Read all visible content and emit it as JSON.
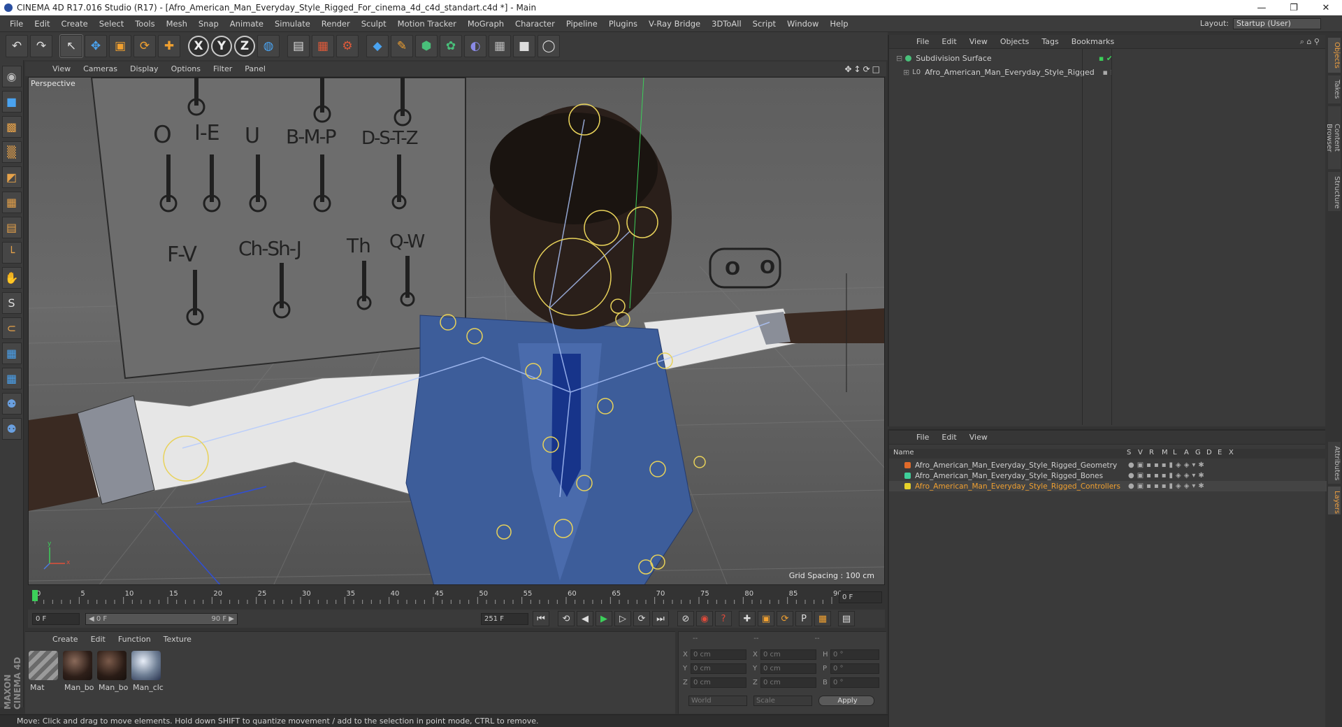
{
  "window": {
    "title": "CINEMA 4D R17.016 Studio (R17) - [Afro_American_Man_Everyday_Style_Rigged_For_cinema_4d_c4d_standart.c4d *] - Main",
    "controls": [
      "—",
      "❐",
      "✕"
    ]
  },
  "menu": [
    "File",
    "Edit",
    "Create",
    "Select",
    "Tools",
    "Mesh",
    "Snap",
    "Animate",
    "Simulate",
    "Render",
    "Sculpt",
    "Motion Tracker",
    "MoGraph",
    "Character",
    "Pipeline",
    "Plugins",
    "V-Ray Bridge",
    "3DToAll",
    "Script",
    "Window",
    "Help"
  ],
  "layout": {
    "label": "Layout:",
    "value": "Startup (User)"
  },
  "toolbar": {
    "icons": [
      "undo-icon",
      "redo-icon",
      "select-arrow-icon",
      "move-icon",
      "scale-icon",
      "rotate-icon",
      "live-move-icon",
      "x-axis-icon",
      "y-axis-icon",
      "z-axis-icon",
      "world-coord-icon",
      "render-view-icon",
      "render-region-icon",
      "render-settings-icon",
      "cube-icon",
      "pen-icon",
      "subdivision-icon",
      "deformer-icon",
      "environment-icon",
      "floor-icon",
      "camera-icon",
      "light-icon"
    ],
    "glyphs": [
      "↶",
      "↷",
      "↖",
      "✥",
      "▣",
      "⟳",
      "✚",
      "X",
      "Y",
      "Z",
      "◍",
      "▤",
      "▦",
      "⚙",
      "◆",
      "✎",
      "⬢",
      "✿",
      "◐",
      "▦",
      "■",
      "◯"
    ]
  },
  "left_tools": [
    "◉",
    "■",
    "▩",
    "▒",
    "◩",
    "▦",
    "▤",
    "└",
    "✋",
    "S",
    "⊂",
    "▦",
    "▦",
    "⚉",
    "⚉"
  ],
  "maxon_text": "MAXON CINEMA 4D",
  "viewport": {
    "menu": [
      "View",
      "Cameras",
      "Display",
      "Options",
      "Filter",
      "Panel"
    ],
    "nav_icons": "✥↕⟳□",
    "label": "Perspective",
    "grid_spacing": "Grid Spacing : 100 cm",
    "phonemes_top": [
      "O",
      "I-E",
      "U",
      "B-M-P",
      "D-S-T-Z"
    ],
    "phonemes_bottom": [
      "F-V",
      "Ch-Sh-J",
      "Th",
      "Q-W"
    ],
    "axis_y": "y",
    "axis_x": "x"
  },
  "timeline": {
    "ticks": [
      "0",
      "5",
      "10",
      "15",
      "20",
      "25",
      "30",
      "35",
      "40",
      "45",
      "50",
      "55",
      "60",
      "65",
      "70",
      "75",
      "80",
      "85",
      "90"
    ],
    "current_frame": "0 F"
  },
  "transport": {
    "start": "0 F",
    "range_start": "◀ 0 F",
    "range_end": "90 F ▶",
    "end": "251 F",
    "buttons": [
      "⏮",
      "⟲",
      "◀",
      "▶",
      "▷",
      "⟳",
      "⏭"
    ],
    "record_buttons": [
      "⊘",
      "◉",
      "?",
      "✚",
      "▣",
      "⟳",
      "P",
      "▦",
      "▤"
    ]
  },
  "materials": {
    "menu": [
      "Create",
      "Edit",
      "Function",
      "Texture"
    ],
    "items": [
      {
        "label": "Mat",
        "color": "#8a8a8a"
      },
      {
        "label": "Man_bo",
        "color": "#3a2a22"
      },
      {
        "label": "Man_bo",
        "color": "#2e211b"
      },
      {
        "label": "Man_clc",
        "color": "#6f7f95"
      }
    ]
  },
  "coordinates": {
    "header": [
      "--",
      "--",
      "--"
    ],
    "rows": [
      {
        "a": "X",
        "av": "0 cm",
        "b": "X",
        "bv": "0 cm",
        "c": "H",
        "cv": "0 °"
      },
      {
        "a": "Y",
        "av": "0 cm",
        "b": "Y",
        "bv": "0 cm",
        "c": "P",
        "cv": "0 °"
      },
      {
        "a": "Z",
        "av": "0 cm",
        "b": "Z",
        "bv": "0 cm",
        "c": "B",
        "cv": "0 °"
      }
    ],
    "mode_world": "World",
    "mode_scale": "Scale",
    "apply": "Apply"
  },
  "status": "Move: Click and drag to move elements. Hold down SHIFT to quantize movement / add to the selection in point mode, CTRL to remove.",
  "objects": {
    "menu": [
      "File",
      "Edit",
      "View",
      "Objects",
      "Tags",
      "Bookmarks"
    ],
    "items": [
      {
        "name": "Subdivision Surface",
        "color": "#49c07a"
      },
      {
        "name": "Afro_American_Man_Everyday_Style_Rigged",
        "color": "#cfcfcf"
      }
    ]
  },
  "layers": {
    "menu": [
      "File",
      "Edit",
      "View"
    ],
    "columns": [
      "Name",
      "S",
      "V",
      "R",
      "M",
      "L",
      "A",
      "G",
      "D",
      "E",
      "X"
    ],
    "items": [
      {
        "name": "Afro_American_Man_Everyday_Style_Rigged_Geometry",
        "color": "#e06a2a",
        "text": "#d0d0d0"
      },
      {
        "name": "Afro_American_Man_Everyday_Style_Rigged_Bones",
        "color": "#3fcf9a",
        "text": "#d0d0d0"
      },
      {
        "name": "Afro_American_Man_Everyday_Style_Rigged_Controllers",
        "color": "#e6d22a",
        "text": "#f0a030"
      }
    ]
  },
  "right_tabs": [
    "Objects",
    "Takes",
    "Content Browser",
    "Structure",
    "Attributes",
    "Layers"
  ]
}
